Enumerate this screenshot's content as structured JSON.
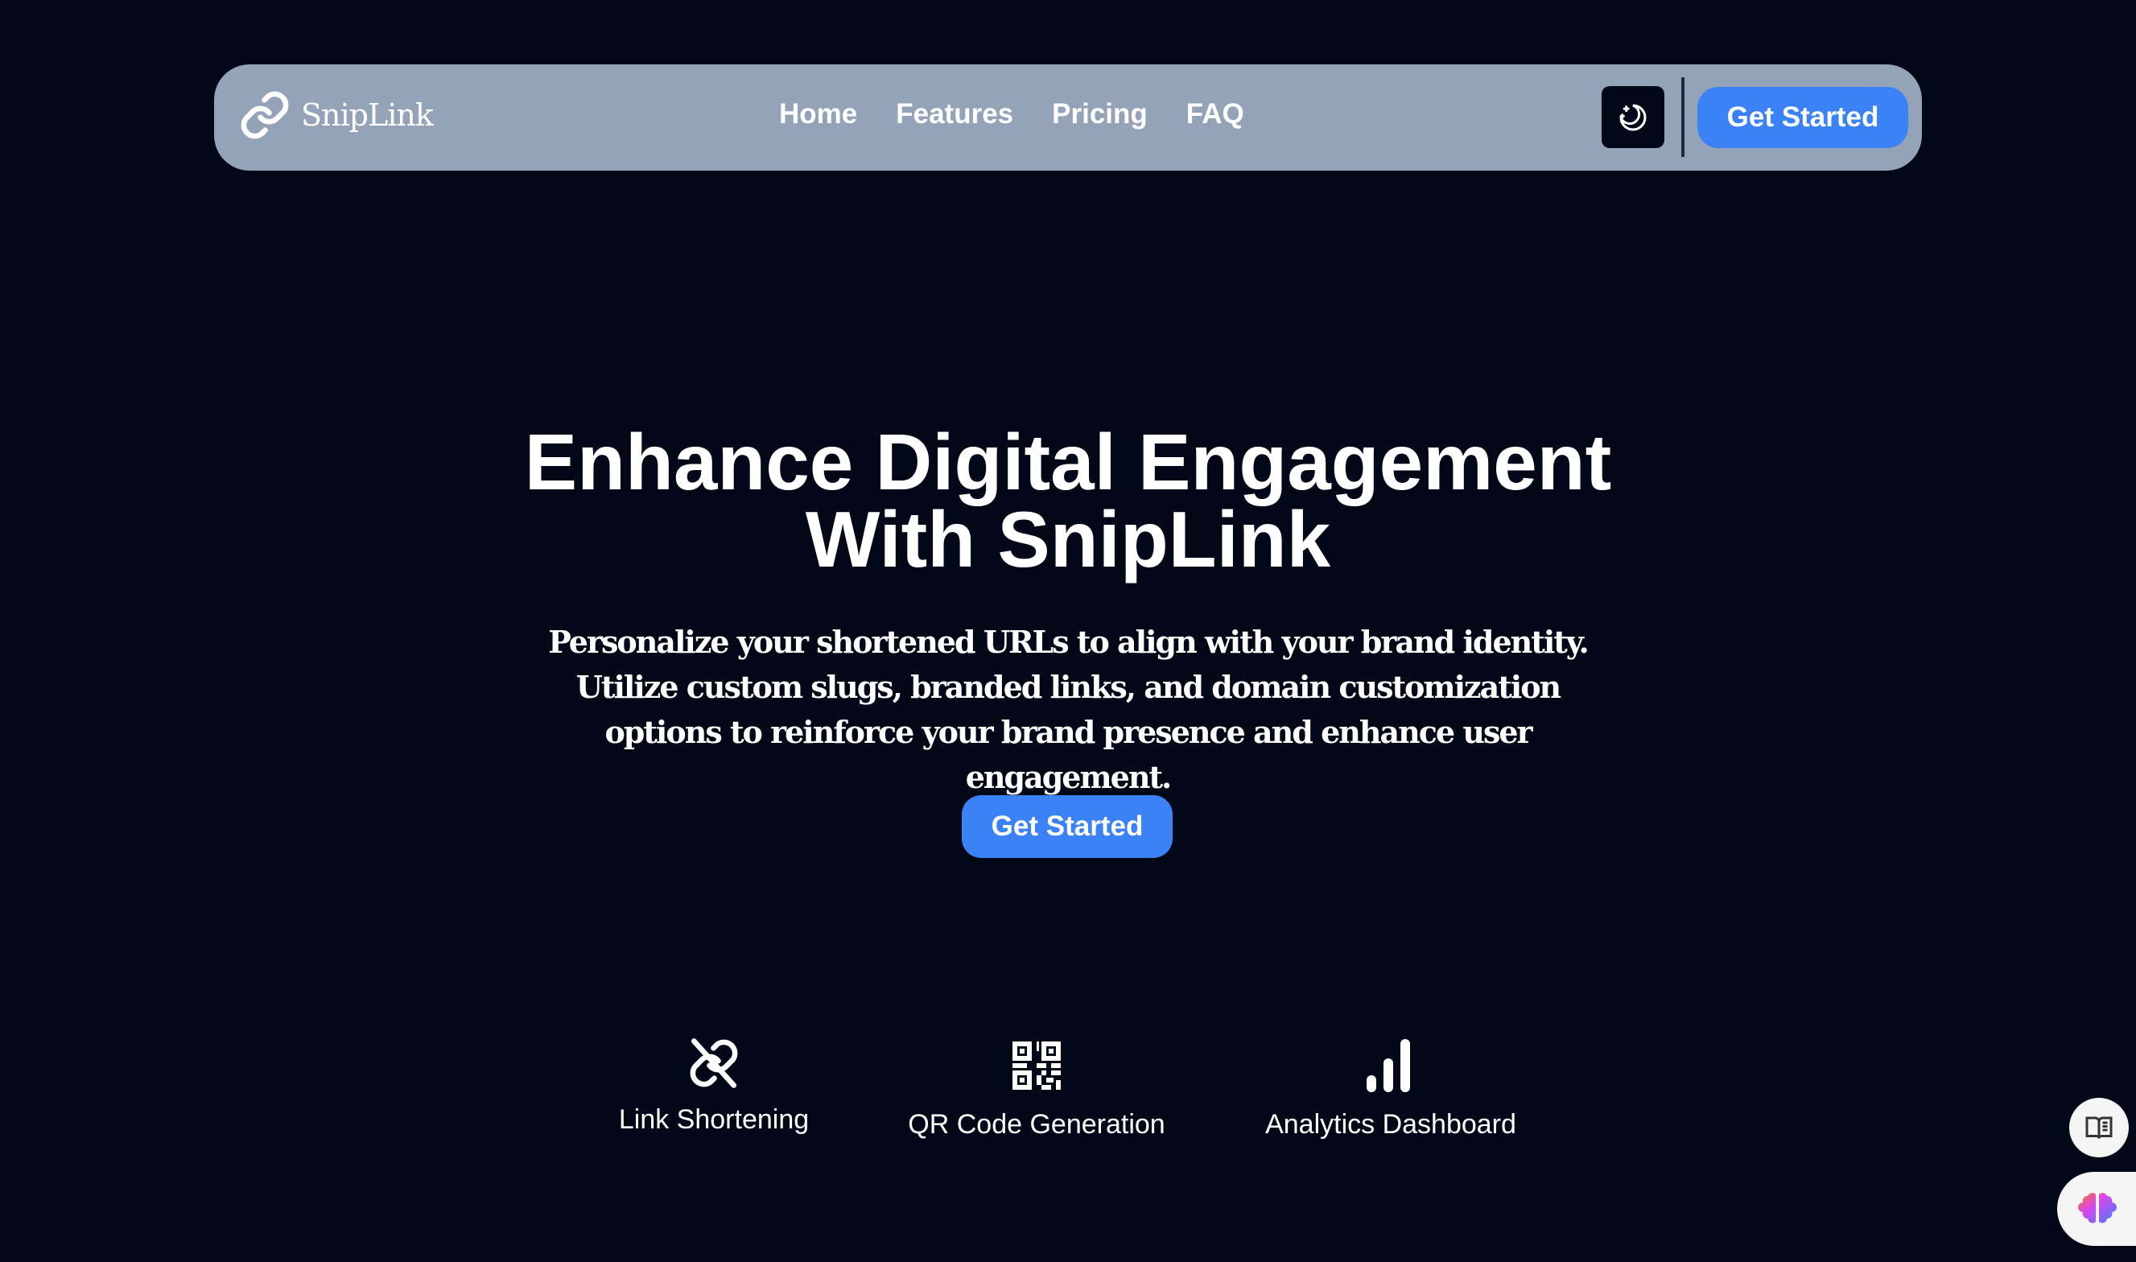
{
  "nav": {
    "brand": "SnipLink",
    "links": [
      "Home",
      "Features",
      "Pricing",
      "FAQ"
    ],
    "theme_icon": "moon-stars-icon",
    "cta": "Get Started"
  },
  "hero": {
    "title_line1": "Enhance Digital Engagement",
    "title_line2": "With SnipLink",
    "subtitle": "Personalize your shortened URLs to align with your brand identity. Utilize custom slugs, branded links, and domain customization options to reinforce your brand presence and enhance user engagement.",
    "cta": "Get Started"
  },
  "features": [
    {
      "label": "Link Shortening",
      "icon": "unlink-icon"
    },
    {
      "label": "QR Code Generation",
      "icon": "qr-code-icon"
    },
    {
      "label": "Analytics Dashboard",
      "icon": "bar-chart-icon"
    }
  ],
  "colors": {
    "background": "#020817",
    "nav": "#94a3b8",
    "accent": "#3b82f6"
  }
}
